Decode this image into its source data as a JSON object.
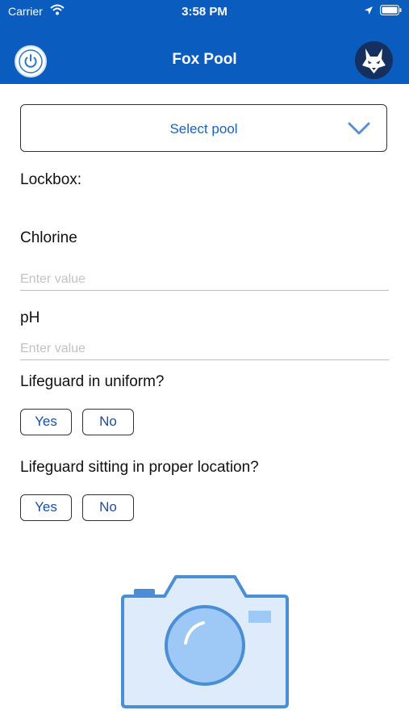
{
  "status_bar": {
    "carrier": "Carrier",
    "time": "3:58 PM"
  },
  "header": {
    "title": "Fox Pool",
    "power_icon": "power-icon",
    "logo": "fox-logo"
  },
  "pool_select": {
    "label": "Select pool",
    "icon": "chevron-down-icon"
  },
  "form": {
    "lockbox_label": "Lockbox:",
    "chlorine": {
      "label": "Chlorine",
      "placeholder": "Enter value",
      "value": ""
    },
    "ph": {
      "label": "pH",
      "placeholder": "Enter value",
      "value": ""
    },
    "uniform": {
      "question": "Lifeguard in uniform?",
      "yes": "Yes",
      "no": "No"
    },
    "location": {
      "question": "Lifeguard sitting in proper location?",
      "yes": "Yes",
      "no": "No"
    }
  },
  "camera": {
    "icon": "camera-icon"
  },
  "colors": {
    "header_bg": "#0a5dbf",
    "accent": "#1a63b8",
    "camera_fill": "#deebfa",
    "camera_stroke": "#4a8fd6"
  }
}
